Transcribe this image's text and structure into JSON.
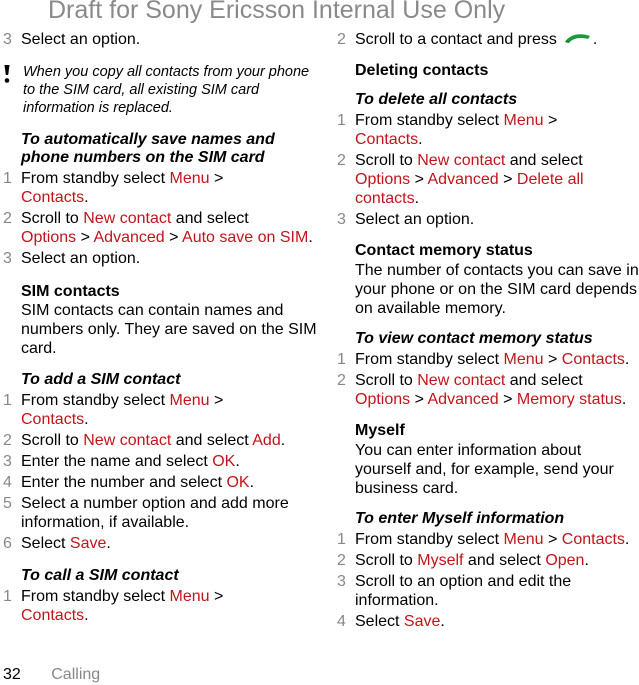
{
  "watermark": "Draft for Sony Ericsson Internal Use Only",
  "left_column": {
    "intro_step": {
      "num": "3",
      "text": "Select an option."
    },
    "note": "When you copy all contacts from your phone to the SIM card, all existing SIM card information is replaced.",
    "auto_save": {
      "title": "To automatically save names and phone numbers on the SIM card",
      "steps": [
        {
          "num": "1",
          "a": "From standby select ",
          "b": "Menu",
          "c": " > ",
          "d": "Contacts",
          "e": "."
        },
        {
          "num": "2",
          "a": "Scroll to ",
          "b": "New contact",
          "c": " and select ",
          "d": "Options",
          "e": " > ",
          "f": "Advanced",
          "g": " > ",
          "h": "Auto save on SIM",
          "i": "."
        },
        {
          "num": "3",
          "a": "Select an option."
        }
      ]
    },
    "sim_contacts": {
      "heading": "SIM contacts",
      "body": "SIM contacts can contain names and numbers only. They are saved on the SIM card."
    },
    "add_sim": {
      "title": "To add a SIM contact",
      "steps": [
        {
          "num": "1",
          "a": "From standby select ",
          "b": "Menu",
          "c": " > ",
          "d": "Contacts",
          "e": "."
        },
        {
          "num": "2",
          "a": "Scroll to ",
          "b": "New contact",
          "c": " and select ",
          "d": "Add",
          "e": "."
        },
        {
          "num": "3",
          "a": "Enter the name and select ",
          "b": "OK",
          "c": "."
        },
        {
          "num": "4",
          "a": "Enter the number and select ",
          "b": "OK",
          "c": "."
        },
        {
          "num": "5",
          "a": "Select a number option and add more information, if available."
        },
        {
          "num": "6",
          "a": "Select ",
          "b": "Save",
          "c": "."
        }
      ]
    },
    "call_sim": {
      "title": "To call a SIM contact",
      "steps": [
        {
          "num": "1",
          "a": "From standby select ",
          "b": "Menu",
          "c": " > ",
          "d": "Contacts",
          "e": "."
        }
      ]
    }
  },
  "right_column": {
    "intro_step": {
      "num": "2",
      "text": "Scroll to a contact and press",
      "end": ".",
      "icon": "call-key-icon"
    },
    "deleting": {
      "heading": "Deleting contacts",
      "title": "To delete all contacts",
      "steps": [
        {
          "num": "1",
          "a": "From standby select ",
          "b": "Menu",
          "c": " > ",
          "d": "Contacts",
          "e": "."
        },
        {
          "num": "2",
          "a": "Scroll to ",
          "b": "New contact",
          "c": " and select ",
          "d": "Options",
          "e": " > ",
          "f": "Advanced",
          "g": " > ",
          "h": "Delete all contacts",
          "i": "."
        },
        {
          "num": "3",
          "a": "Select an option."
        }
      ]
    },
    "memory": {
      "heading": "Contact memory status",
      "body": "The number of contacts you can save in your phone or on the SIM card depends on available memory.",
      "title": "To view contact memory status",
      "steps": [
        {
          "num": "1",
          "a": "From standby select ",
          "b": "Menu",
          "c": " > ",
          "d": "Contacts",
          "e": "."
        },
        {
          "num": "2",
          "a": "Scroll to ",
          "b": "New contact",
          "c": " and select ",
          "d": "Options",
          "e": " > ",
          "f": "Advanced",
          "g": " > ",
          "h": "Memory status",
          "i": "."
        }
      ]
    },
    "myself": {
      "heading": "Myself",
      "body": "You can enter information about yourself and, for example, send your business card.",
      "title": "To enter Myself information",
      "steps": [
        {
          "num": "1",
          "a": "From standby select ",
          "b": "Menu",
          "c": " > ",
          "d": "Contacts",
          "e": "."
        },
        {
          "num": "2",
          "a": "Scroll to ",
          "b": "Myself",
          "c": " and select ",
          "d": "Open",
          "e": "."
        },
        {
          "num": "3",
          "a": "Scroll to an option and edit the information."
        },
        {
          "num": "4",
          "a": "Select ",
          "b": "Save",
          "c": "."
        }
      ]
    }
  },
  "footer": {
    "page_number": "32",
    "section": "Calling"
  },
  "colors": {
    "highlight": "#c3141b",
    "step_number": "#888888",
    "watermark": "#8a8a8a",
    "call_icon": "#1a9a3c"
  }
}
